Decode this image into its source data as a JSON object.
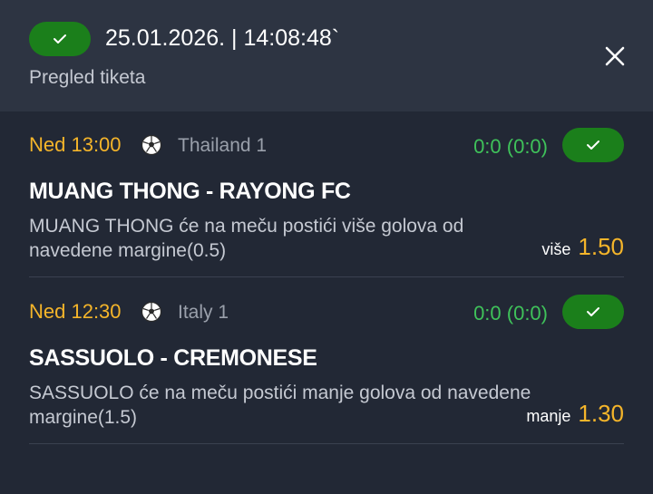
{
  "header": {
    "datetime": "25.01.2026. | 14:08:48`",
    "subtitle": "Pregled tiketa",
    "status_icon": "check-icon",
    "close_icon": "close-icon"
  },
  "colors": {
    "background": "#222835",
    "header_background": "#2d3442",
    "accent_orange": "#f5b52a",
    "score_green": "#3fc25a",
    "status_green": "#1b7f1b"
  },
  "matches": [
    {
      "time": "Ned 13:00",
      "sport_icon": "soccer-ball-icon",
      "league": "Thailand 1",
      "score": "0:0 (0:0)",
      "teams": "MUANG THONG - RAYONG FC",
      "description": "MUANG THONG će na meču postići više golova od navedene margine(0.5)",
      "pick_label": "više",
      "odds": "1.50"
    },
    {
      "time": "Ned 12:30",
      "sport_icon": "soccer-ball-icon",
      "league": "Italy 1",
      "score": "0:0 (0:0)",
      "teams": "SASSUOLO - CREMONESE",
      "description": "SASSUOLO će na meču postići manje golova od navedene margine(1.5)",
      "pick_label": "manje",
      "odds": "1.30"
    }
  ]
}
